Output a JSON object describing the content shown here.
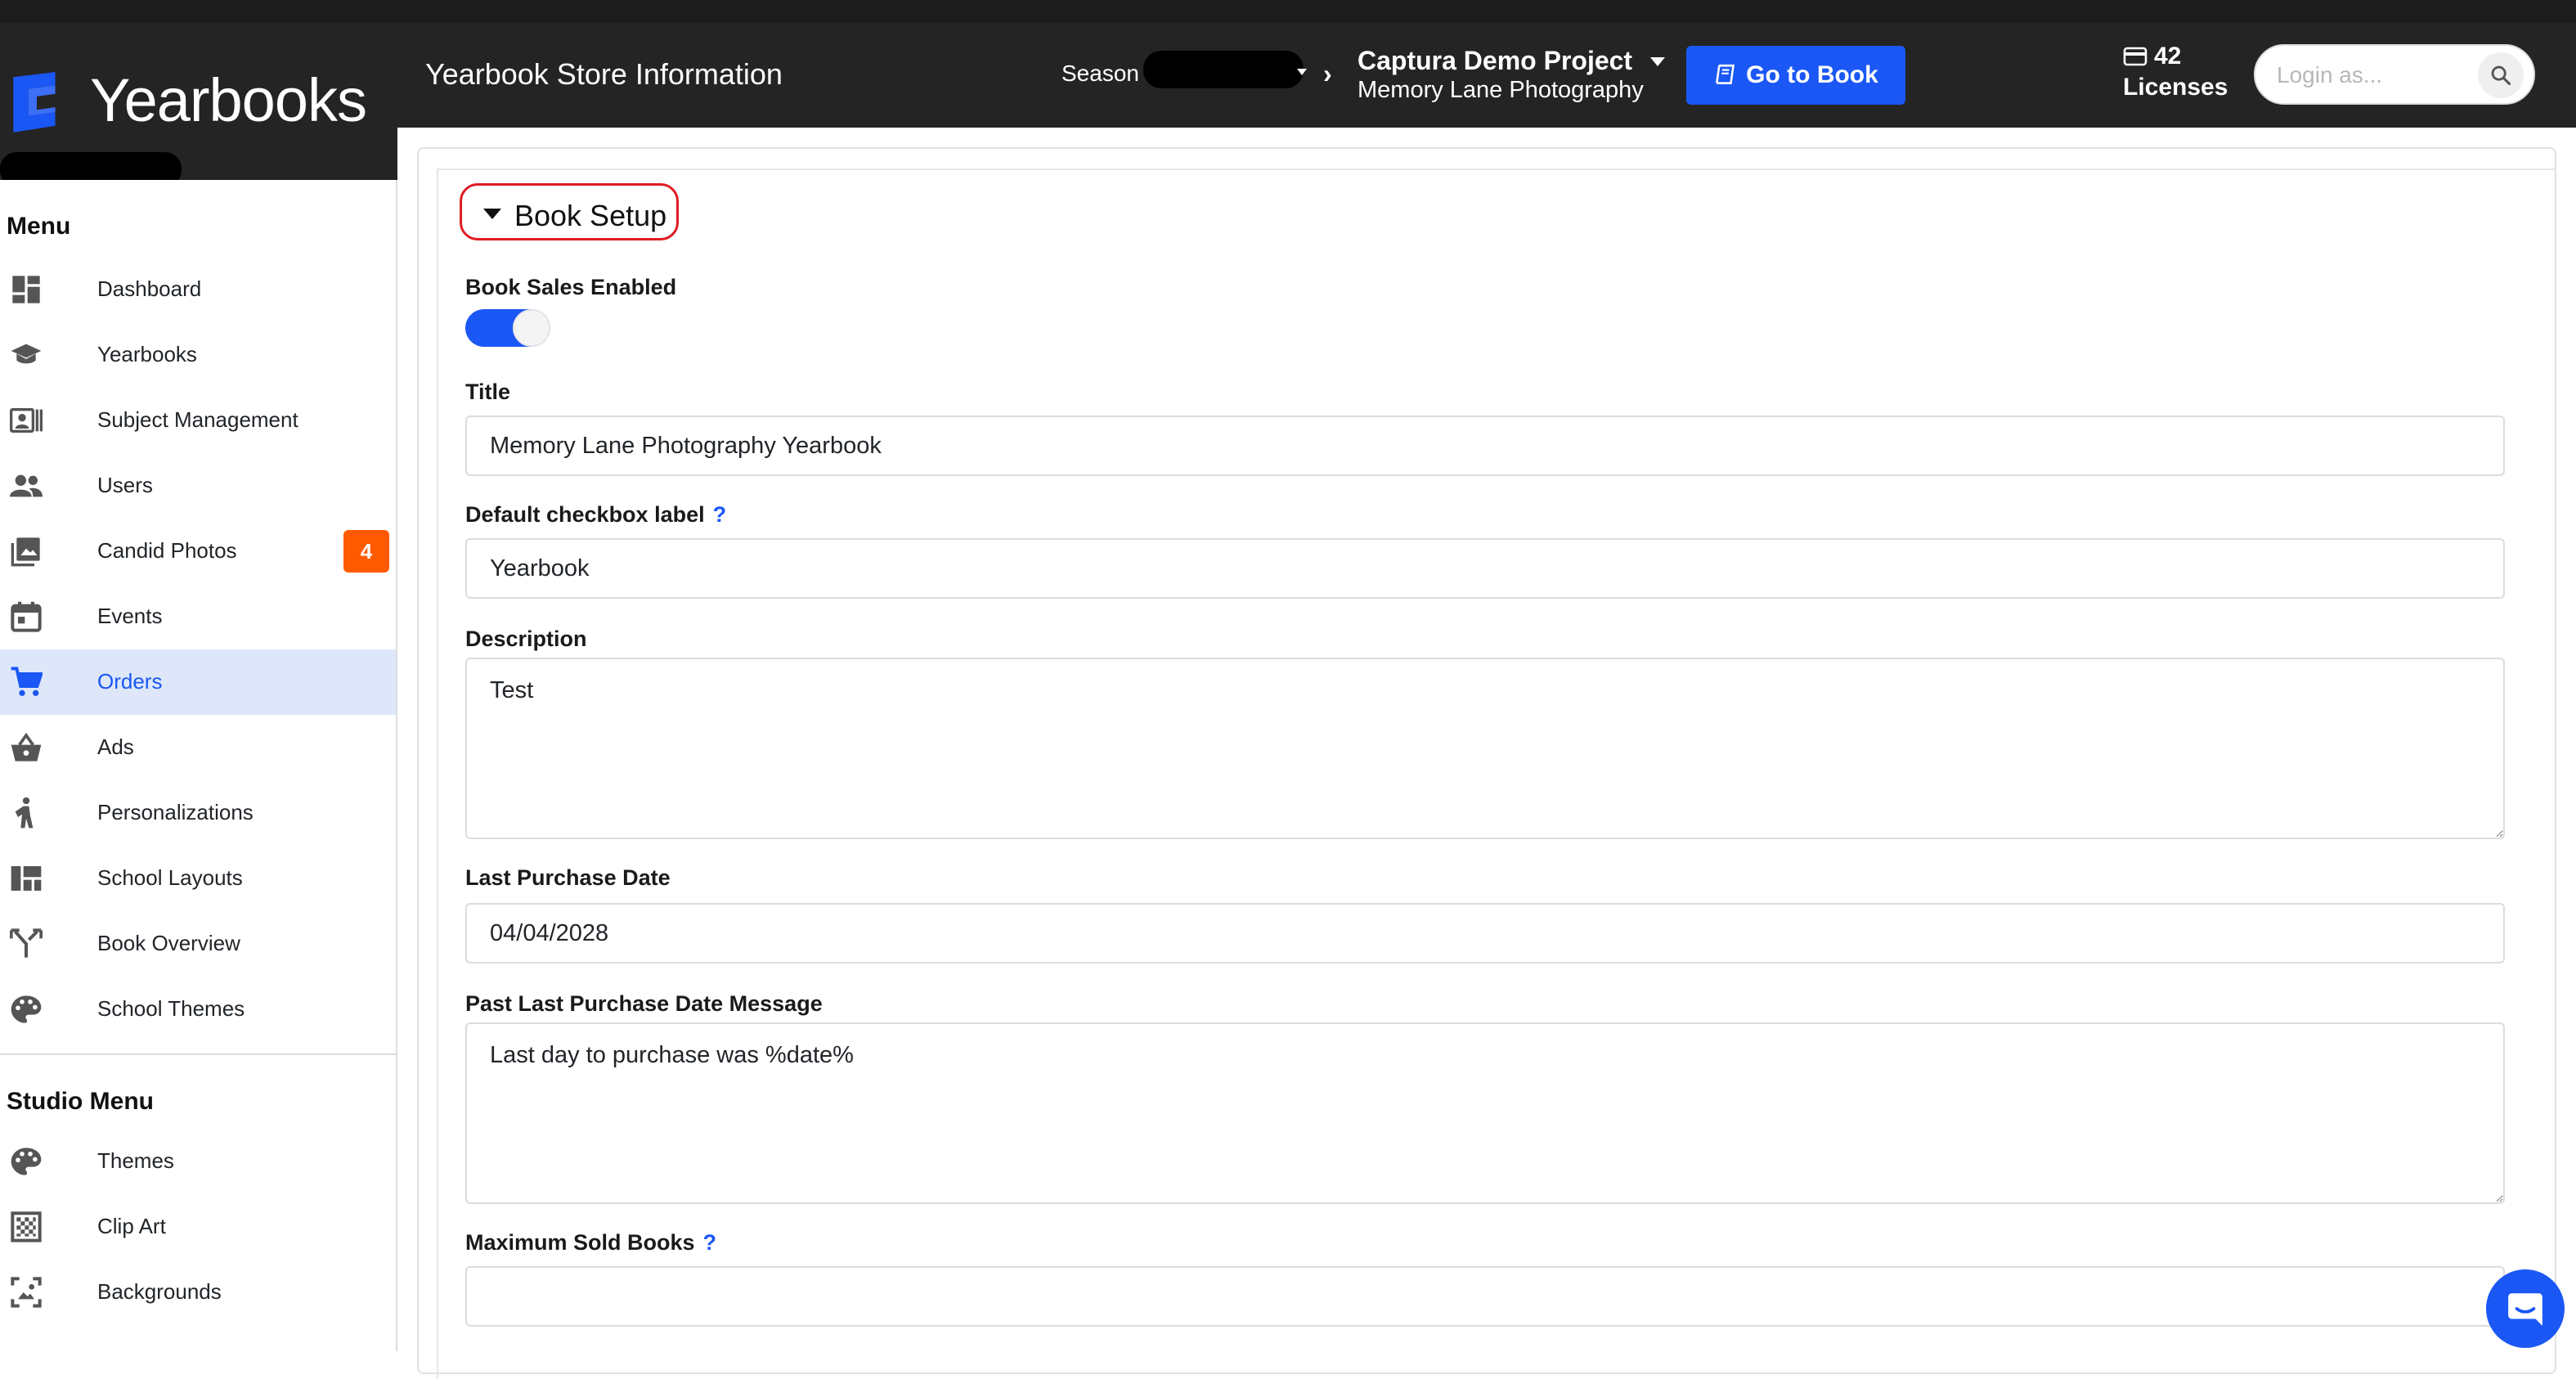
{
  "brand": {
    "name": "Yearbooks",
    "color": "#1a57f5"
  },
  "header": {
    "page_title": "Yearbook Store Information",
    "season_label": "Season",
    "project_name": "Captura Demo Project",
    "studio_name": "Memory Lane Photography",
    "go_to_book_label": "Go to Book",
    "licenses_count": "42",
    "licenses_label": "Licenses",
    "login_placeholder": "Login as..."
  },
  "sidebar": {
    "menu_heading": "Menu",
    "items": [
      {
        "label": "Dashboard",
        "icon": "dashboard-icon"
      },
      {
        "label": "Yearbooks",
        "icon": "graduation-cap-icon"
      },
      {
        "label": "Subject Management",
        "icon": "contact-card-icon"
      },
      {
        "label": "Users",
        "icon": "users-icon"
      },
      {
        "label": "Candid Photos",
        "icon": "photos-icon",
        "badge": "4"
      },
      {
        "label": "Events",
        "icon": "calendar-icon"
      },
      {
        "label": "Orders",
        "icon": "cart-icon",
        "active": true
      },
      {
        "label": "Ads",
        "icon": "basket-icon"
      },
      {
        "label": "Personalizations",
        "icon": "person-icon"
      },
      {
        "label": "School Layouts",
        "icon": "layout-icon"
      },
      {
        "label": "Book Overview",
        "icon": "merge-icon"
      },
      {
        "label": "School Themes",
        "icon": "palette-icon"
      }
    ],
    "studio_heading": "Studio Menu",
    "studio_items": [
      {
        "label": "Themes",
        "icon": "palette-icon"
      },
      {
        "label": "Clip Art",
        "icon": "clip-art-icon"
      },
      {
        "label": "Backgrounds",
        "icon": "backgrounds-icon"
      }
    ]
  },
  "form": {
    "section_title": "Book Setup",
    "sales_enabled_label": "Book Sales Enabled",
    "sales_enabled": true,
    "title_label": "Title",
    "title_value": "Memory Lane Photography Yearbook",
    "checkbox_label_label": "Default checkbox label",
    "checkbox_label_value": "Yearbook",
    "description_label": "Description",
    "description_value": "Test",
    "last_purchase_label": "Last Purchase Date",
    "last_purchase_value": "04/04/2028",
    "past_message_label": "Past Last Purchase Date Message",
    "past_message_value": "Last day to purchase was %date%",
    "max_sold_label": "Maximum Sold Books",
    "max_sold_value": "",
    "help_mark": "?"
  },
  "colors": {
    "accent": "#1a57f5",
    "badge": "#ff5a00",
    "highlight": "#e01b24",
    "header": "#242424"
  }
}
